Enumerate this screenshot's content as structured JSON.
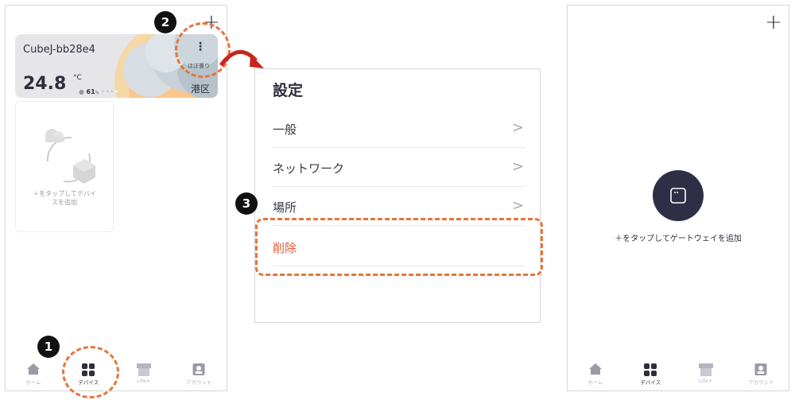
{
  "left_screen": {
    "add_icon": "+",
    "device_card": {
      "name": "CubeJ-bb28e4",
      "temperature": "24.8",
      "unit": "°C",
      "humidity": "61",
      "humidity_unit": "%",
      "weather": "ほぼ曇り",
      "area": "港区",
      "menu_icon": "vertical-ellipsis"
    },
    "add_device_text": "＋をタップしてデバイスを追加",
    "tabs": [
      {
        "label": "ホーム",
        "icon": "home-icon",
        "active": false
      },
      {
        "label": "デバイス",
        "icon": "grid-icon",
        "active": true
      },
      {
        "label": "Life+",
        "icon": "store-icon",
        "active": false
      },
      {
        "label": "アカウント",
        "icon": "account-icon",
        "active": false
      }
    ]
  },
  "settings_panel": {
    "title": "設定",
    "items": [
      {
        "label": "一般",
        "chevron": ">"
      },
      {
        "label": "ネットワーク",
        "chevron": ">"
      },
      {
        "label": "場所",
        "chevron": ">"
      },
      {
        "label": "削除",
        "chevron": ""
      }
    ]
  },
  "right_screen": {
    "add_icon": "+",
    "add_gateway_text": "＋をタップしてゲートウェイを追加",
    "tabs": [
      {
        "label": "ホーム",
        "icon": "home-icon",
        "active": false
      },
      {
        "label": "デバイス",
        "icon": "grid-icon",
        "active": true
      },
      {
        "label": "Life+",
        "icon": "store-icon",
        "active": false
      },
      {
        "label": "アカウント",
        "icon": "account-icon",
        "active": false
      }
    ]
  },
  "annotations": {
    "step1": "1",
    "step2": "2",
    "step3": "3",
    "highlight_color": "#e8743b"
  }
}
